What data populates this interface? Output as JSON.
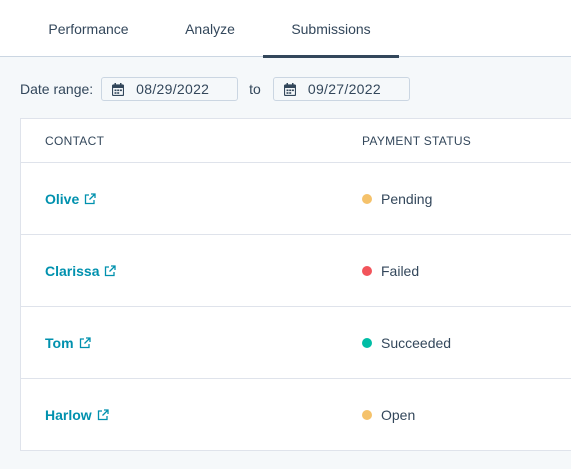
{
  "tabs": [
    {
      "label": "Performance",
      "active": false
    },
    {
      "label": "Analyze",
      "active": false
    },
    {
      "label": "Submissions",
      "active": true
    }
  ],
  "date_range": {
    "label": "Date range:",
    "start": "08/29/2022",
    "to_label": "to",
    "end": "09/27/2022",
    "icon": "calendar-icon"
  },
  "table": {
    "columns": [
      "CONTACT",
      "PAYMENT STATUS"
    ],
    "rows": [
      {
        "contact": "Olive",
        "status": "Pending",
        "status_color": "#f5c26b"
      },
      {
        "contact": "Clarissa",
        "status": "Failed",
        "status_color": "#f2545b"
      },
      {
        "contact": "Tom",
        "status": "Succeeded",
        "status_color": "#00bda5"
      },
      {
        "contact": "Harlow",
        "status": "Open",
        "status_color": "#f5c26b"
      }
    ]
  },
  "colors": {
    "link": "#0091ae",
    "text": "#33475b",
    "border": "#cbd6e2",
    "background": "#f5f8fa"
  }
}
